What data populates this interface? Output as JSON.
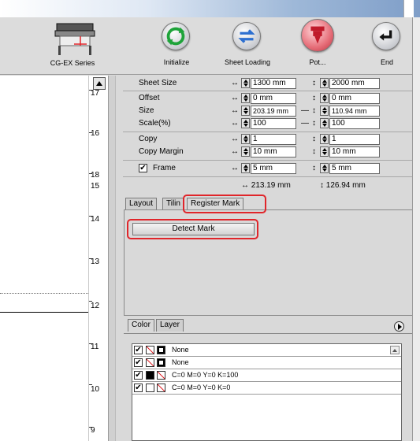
{
  "toolbar": {
    "device_label": "CG-EX Series",
    "initialize_label": "Initialize",
    "sheet_loading_label": "Sheet Loading",
    "plot_label": "Pot...",
    "end_label": "End"
  },
  "ruler": {
    "numbers": [
      "17",
      "16",
      "18",
      "15",
      "14",
      "13",
      "12",
      "11",
      "10",
      "9"
    ]
  },
  "settings": {
    "sheet_size": {
      "label": "Sheet Size",
      "w": "1300 mm",
      "h": "2000 mm"
    },
    "offset": {
      "label": "Offset",
      "w": "0 mm",
      "h": "0 mm"
    },
    "size": {
      "label": "Size",
      "w": "203.19 mm",
      "h": "110.94 mm"
    },
    "scale": {
      "label": "Scale(%)",
      "w": "100",
      "h": "100"
    },
    "copy": {
      "label": "Copy",
      "w": "1",
      "h": "1"
    },
    "copy_margin": {
      "label": "Copy Margin",
      "w": "10 mm",
      "h": "10 mm"
    },
    "frame": {
      "label": "Frame",
      "checked": "✔",
      "w": "5 mm",
      "h": "5 mm"
    },
    "totals": {
      "w": "↔ 213.19 mm",
      "h": "↕ 126.94 mm"
    }
  },
  "tabs": {
    "layout": "Layout",
    "tiling": "Tilin",
    "register_mark": "Register Mark"
  },
  "register_mark": {
    "detect_button": "Detect Mark"
  },
  "color_tabs": {
    "color": "Color",
    "layer": "Layer"
  },
  "color_rows": [
    {
      "checked": "✔",
      "fill": "none",
      "stroke": "black",
      "text": "None"
    },
    {
      "checked": "✔",
      "fill": "none",
      "stroke": "black",
      "text": "None"
    },
    {
      "checked": "✔",
      "fill": "black",
      "stroke": "none",
      "text": "C=0 M=0 Y=0 K=100"
    },
    {
      "checked": "✔",
      "fill": "white",
      "stroke": "none",
      "text": "C=0 M=0 Y=0 K=0"
    }
  ],
  "colors": {
    "highlight": "#e0252a",
    "titlebar": "#9eb8d8"
  }
}
